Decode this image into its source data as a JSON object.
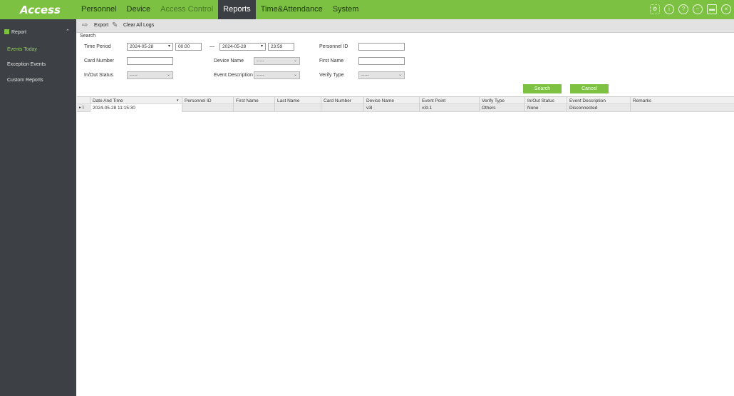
{
  "app": {
    "logo": "Access",
    "nav": [
      "Personnel",
      "Device",
      "Access Control",
      "Reports",
      "Time&Attendance",
      "System"
    ],
    "active_nav": "Reports",
    "window_icons": [
      "gear-icon",
      "info-icon",
      "help-icon",
      "minimize-icon",
      "maximize-icon",
      "close-icon"
    ]
  },
  "sidebar": {
    "header": "Report",
    "items": [
      {
        "label": "Events Today",
        "active": true
      },
      {
        "label": "Exception Events"
      },
      {
        "label": "Custom Reports"
      }
    ]
  },
  "toolbar": {
    "export": "Export",
    "clear": "Clear All Logs"
  },
  "search": {
    "legend": "Search",
    "time_period_label": "Time Period",
    "start_date": "2024-05-28",
    "start_time": "00:00",
    "sep": "—",
    "end_date": "2024-05-28",
    "end_time": "23:59",
    "personnel_id_label": "Personnel ID",
    "personnel_id": "",
    "card_number_label": "Card Number",
    "card_number": "",
    "device_name_label": "Device Name",
    "device_name": "-----",
    "first_name_label": "First Name",
    "first_name": "",
    "inout_label": "In/Out Status",
    "inout": "-----",
    "event_desc_label": "Event Description",
    "event_desc": "-----",
    "verify_label": "Verify Type",
    "verify": "-----",
    "search_btn": "Search",
    "cancel_btn": "Cancel"
  },
  "table": {
    "columns": [
      "Date And Time",
      "Personnel ID",
      "First Name",
      "Last Name",
      "Card Number",
      "Device Name",
      "Event Point",
      "Verify Type",
      "In/Out Status",
      "Event Description",
      "Remarks"
    ],
    "rows": [
      {
        "num": "1",
        "cells": [
          "2024-05-28 11:15:30",
          "",
          "",
          "",
          "",
          "v3l",
          "v3l-1",
          "Others",
          "None",
          "Disconnected",
          ""
        ]
      }
    ]
  },
  "colors": {
    "accent": "#7cc142",
    "sidebar": "#3d4145"
  }
}
